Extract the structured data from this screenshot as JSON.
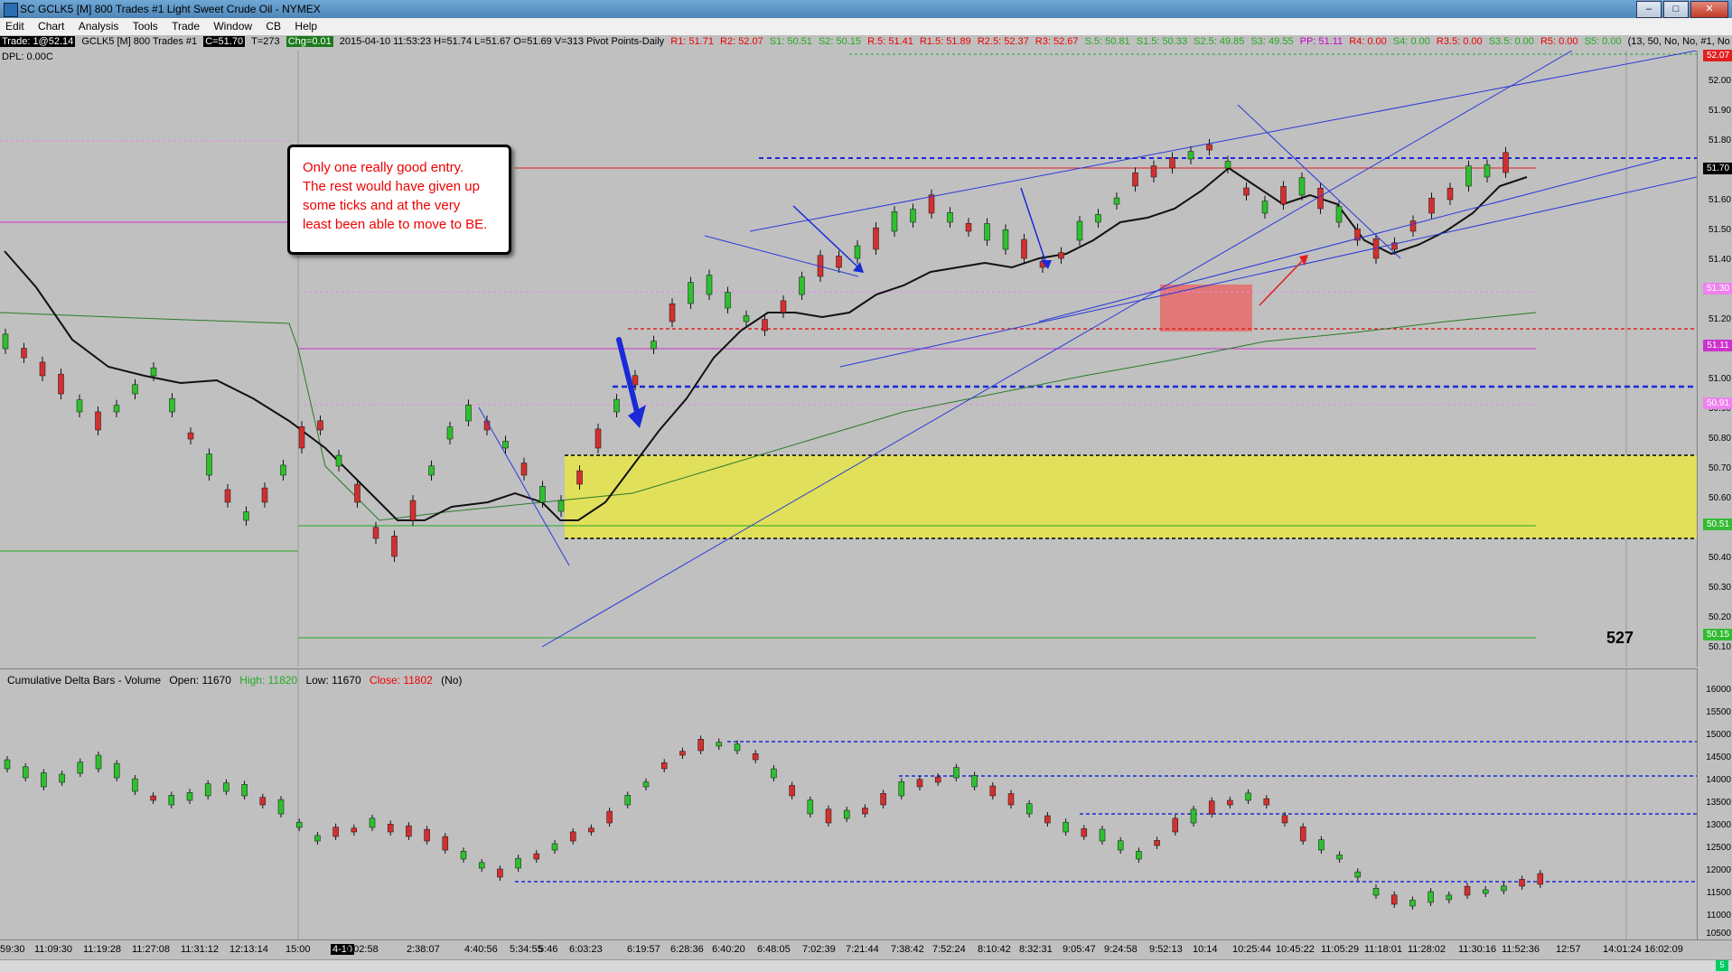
{
  "window": {
    "title": "SC GCLK5 [M]  800 Trades  #1  Light Sweet Crude Oil - NYMEX",
    "buttons": {
      "minimize": "–",
      "maximize": "□",
      "close": "✕"
    }
  },
  "menu": [
    "Edit",
    "Chart",
    "Analysis",
    "Tools",
    "Trade",
    "Window",
    "CB",
    "Help"
  ],
  "infobar": {
    "trade": "Trade: 1@52.14",
    "symbol": "GCLK5 [M]  800 Trades  #1",
    "close": "C=51.70",
    "t": "T=273",
    "chg": "Chg=0.01",
    "bar": "2015-04-10 11:53:23 H=51.74 L=51.67 O=51.69 V=313 Pivot Points-Daily",
    "r1": "R1: 51.71",
    "r2": "R2: 52.07",
    "s1": "S1: 50.51",
    "s2": "S2: 50.15",
    "r05": "R.5: 51.41",
    "r15": "R1.5: 51.89",
    "r25": "R2.5: 52.37",
    "r3": "R3: 52.67",
    "s05": "S.5: 50.81",
    "s15": "S1.5: 50.33",
    "s25": "S2.5: 49.85",
    "s3": "S3: 49.55",
    "pp": "PP: 51.11",
    "r4": "R4: 0.00",
    "s4": "S4: 0.00",
    "r35": "R3.5: 0.00",
    "s35": "S3.5: 0.00",
    "r5": "R5: 0.00",
    "s5": "S5: 0.00",
    "params": "(13, 50, No, No, #1, No"
  },
  "dpl": "DPL: 0.00C",
  "note": {
    "lines": [
      "Only one really good entry.",
      "The rest would have given up",
      "some ticks and at the very",
      "least been able to move to BE."
    ]
  },
  "count": "527",
  "price_axis": {
    "ticks": [
      "52.00",
      "51.90",
      "51.80",
      "51.60",
      "51.50",
      "51.40",
      "51.20",
      "51.00",
      "50.90",
      "50.80",
      "50.70",
      "50.60",
      "50.40",
      "50.30",
      "50.20",
      "50.10"
    ],
    "badges": [
      {
        "label": "52.07",
        "color": "#e02020"
      },
      {
        "label": "51.70",
        "color": "#000000"
      },
      {
        "label": "51.30",
        "color": "#ee82ee"
      },
      {
        "label": "51.11",
        "color": "#cc33cc"
      },
      {
        "label": "50.91",
        "color": "#ee82ee"
      },
      {
        "label": "50.51",
        "color": "#33bb33"
      },
      {
        "label": "50.15",
        "color": "#33bb33"
      }
    ]
  },
  "lower": {
    "title": "Cumulative Delta Bars - Volume",
    "open": "Open: 11670",
    "high": "High: 11820",
    "low": "Low: 11670",
    "close": "Close: 11802",
    "flag": "(No)",
    "ticks": [
      "16000",
      "15500",
      "15000",
      "14500",
      "14000",
      "13500",
      "13000",
      "12500",
      "12000",
      "11500",
      "11000",
      "10500"
    ]
  },
  "time_axis": {
    "labels": [
      "59:30",
      "11:09:30",
      "11:19:28",
      "11:27:08",
      "11:31:12",
      "12:13:14",
      "15:00",
      "1:02:58",
      "2:38:07",
      "4:40:56",
      "5:34:55",
      "5:46",
      "6:03:23",
      "6:19:57",
      "6:28:36",
      "6:40:20",
      "6:48:05",
      "7:02:39",
      "7:21:44",
      "7:38:42",
      "7:52:24",
      "8:10:42",
      "8:32:31",
      "9:05:47",
      "9:24:58",
      "9:52:13",
      "10:14",
      "10:25:44",
      "10:45:22",
      "11:05:29",
      "11:18:01",
      "11:28:02",
      "11:30:16",
      "11:52:36",
      "12:57",
      "14:01:24",
      "16:02:09"
    ],
    "date": "4-10"
  },
  "page_indicator": "5"
}
